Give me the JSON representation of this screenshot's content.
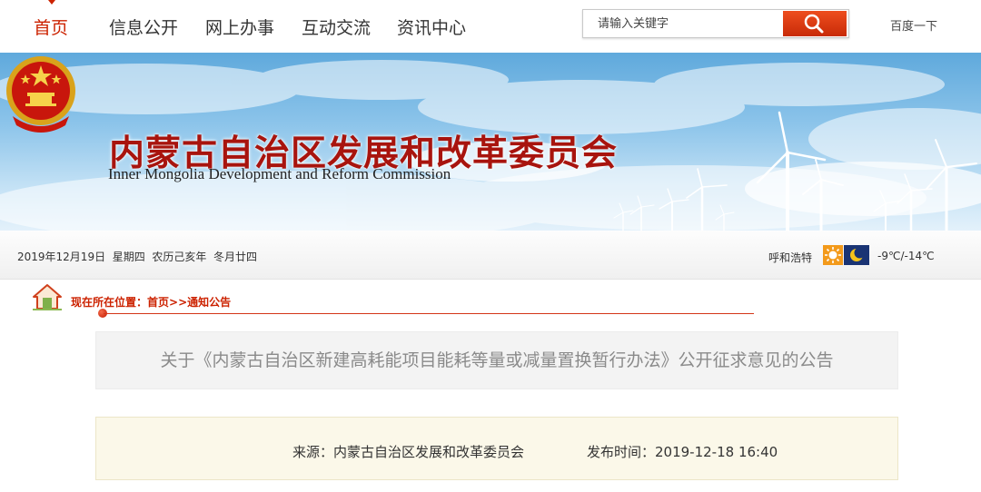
{
  "nav": {
    "items": [
      {
        "label": "首页",
        "active": true
      },
      {
        "label": "信息公开",
        "active": false
      },
      {
        "label": "网上办事",
        "active": false
      },
      {
        "label": "互动交流",
        "active": false
      },
      {
        "label": "资讯中心",
        "active": false
      }
    ],
    "active_color": "#cc2200"
  },
  "search": {
    "placeholder": "请输入关键字",
    "button_icon": "magnifier-icon",
    "baidu_label": "百度一下"
  },
  "banner": {
    "title": "内蒙古自治区发展和改革委员会",
    "subtitle": "Inner Mongolia Development  and Reform Commission",
    "emblem_icon": "national-emblem-icon",
    "title_color": "#a8140e"
  },
  "infobar": {
    "date": "2019年12月19日",
    "weekday": "星期四",
    "lunar": "农历己亥年",
    "lunar_day": "冬月廿四",
    "city": "呼和浩特",
    "weather_icons": [
      "sun-icon",
      "moon-icon"
    ],
    "temperature": "-9℃/-14℃"
  },
  "breadcrumb": {
    "prefix": "现在所在位置：",
    "home": "首页",
    "separator": ">>",
    "current": "通知公告"
  },
  "article": {
    "title": "关于《内蒙古自治区新建高耗能项目能耗等量或减量置换暂行办法》公开征求意见的公告",
    "source": "来源：内蒙古自治区发展和改革委员会",
    "publish_time": "发布时间：2019-12-18 16:40"
  }
}
